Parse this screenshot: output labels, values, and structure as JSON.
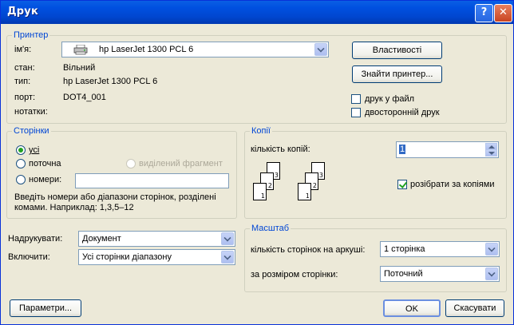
{
  "window": {
    "title": "Друк",
    "help": "?",
    "close": "✕"
  },
  "printer": {
    "legend": "Принтер",
    "name_label": "ім'я:",
    "name_value": "hp LaserJet 1300 PCL 6",
    "status_label": "стан:",
    "status_value": "Вільний",
    "type_label": "тип:",
    "type_value": "hp LaserJet 1300 PCL 6",
    "port_label": "порт:",
    "port_value": "DOT4_001",
    "notes_label": "нотатки:",
    "properties_button": "Властивості",
    "find_button": "Знайти принтер...",
    "print_to_file": "друк у файл",
    "duplex": "двосторонній друк",
    "print_to_file_checked": false,
    "duplex_checked": false
  },
  "pages": {
    "legend": "Сторінки",
    "all": "усі",
    "current": "поточна",
    "selection": "виділений фрагмент",
    "numbers": "номери:",
    "numbers_value": "",
    "selected": "all",
    "hint": "Введіть номери або діапазони сторінок, розділені комами. Наприклад: 1,3,5–12"
  },
  "copies": {
    "legend": "Копії",
    "count_label": "кількість копій:",
    "count_value": "1",
    "collate_label": "розібрати за копіями",
    "collate_checked": true
  },
  "print_what": {
    "label": "Надрукувати:",
    "value": "Документ"
  },
  "include": {
    "label": "Включити:",
    "value": "Усі сторінки діапазону"
  },
  "zoom": {
    "legend": "Масштаб",
    "pages_per_sheet_label": "кількість сторінок на аркуші:",
    "pages_per_sheet_value": "1 сторінка",
    "scale_label": "за розміром сторінки:",
    "scale_value": "Поточний"
  },
  "buttons": {
    "options": "Параметри...",
    "ok": "OK",
    "cancel": "Скасувати"
  },
  "icons": {
    "printer": "printer-icon",
    "collate": "collate-pages-icon"
  }
}
